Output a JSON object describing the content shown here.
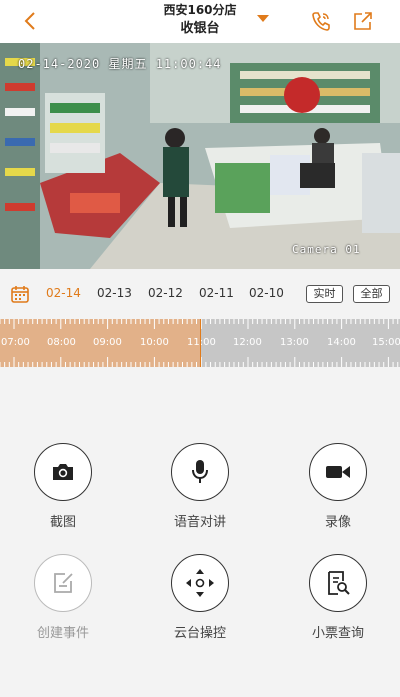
{
  "header": {
    "store_name": "西安160分店",
    "desk_name": "收银台"
  },
  "video": {
    "osd_datetime": "02-14-2020 星期五 11:00:44",
    "osd_camera": "Camera 01"
  },
  "datebar": {
    "dates": [
      "02-14",
      "02-13",
      "02-12",
      "02-11",
      "02-10"
    ],
    "active_index": 0,
    "live_label": "实时",
    "all_label": "全部"
  },
  "timeline": {
    "hours": [
      "07:00",
      "08:00",
      "09:00",
      "10:00",
      "11:00",
      "12:00",
      "13:00",
      "14:00",
      "15:00"
    ],
    "current_time": "11:00"
  },
  "actions": [
    {
      "label": "截图",
      "icon": "camera-icon",
      "enabled": true
    },
    {
      "label": "语音对讲",
      "icon": "microphone-icon",
      "enabled": true
    },
    {
      "label": "录像",
      "icon": "video-camera-icon",
      "enabled": true
    },
    {
      "label": "创建事件",
      "icon": "edit-icon",
      "enabled": false
    },
    {
      "label": "云台操控",
      "icon": "ptz-control-icon",
      "enabled": true
    },
    {
      "label": "小票查询",
      "icon": "receipt-search-icon",
      "enabled": true
    }
  ],
  "colors": {
    "accent": "#e07b1b",
    "timeline_played": "#e2b189",
    "timeline_rest": "#c6c6c6"
  }
}
